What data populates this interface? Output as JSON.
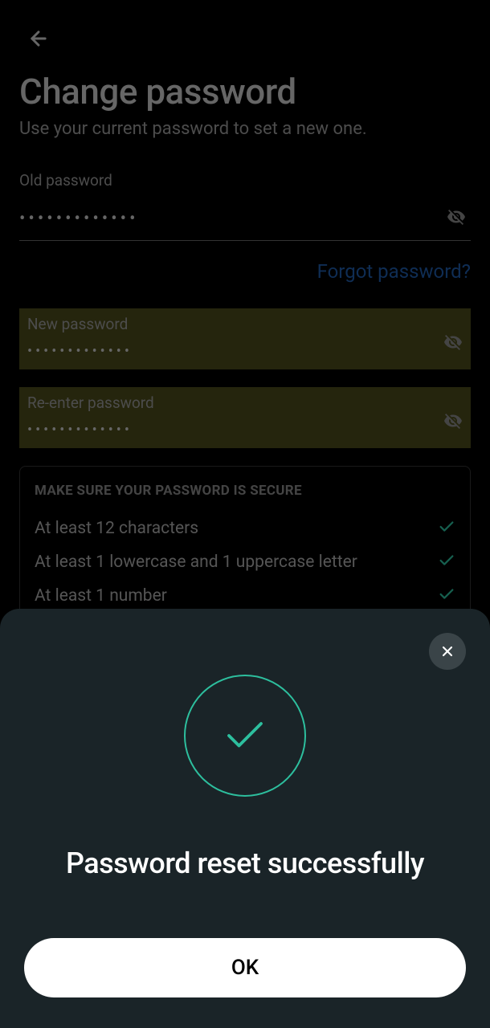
{
  "page": {
    "title": "Change password",
    "subtitle": "Use your current password to set a new one."
  },
  "form": {
    "oldPassword": {
      "label": "Old password",
      "value": "•••••••••••••"
    },
    "forgotLink": "Forgot password?",
    "newPassword": {
      "label": "New password",
      "value": "•••••••••••••"
    },
    "reenterPassword": {
      "label": "Re-enter password",
      "value": "•••••••••••••"
    }
  },
  "requirements": {
    "title": "MAKE SURE YOUR PASSWORD IS SECURE",
    "items": [
      "At least 12 characters",
      "At least 1 lowercase and 1 uppercase letter",
      "At least 1 number"
    ]
  },
  "modal": {
    "title": "Password reset successfully",
    "okButton": "OK"
  }
}
